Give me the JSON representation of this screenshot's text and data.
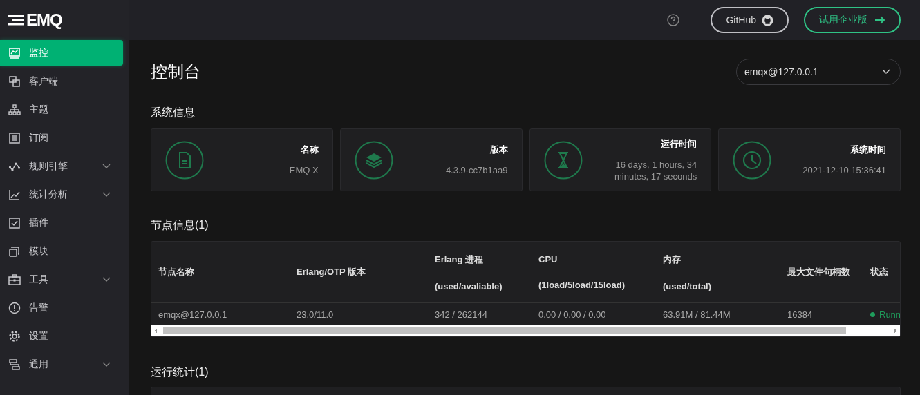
{
  "logo": {
    "text": "EMQ"
  },
  "sidebar": {
    "items": [
      {
        "label": "监控",
        "selected": true,
        "expandable": false
      },
      {
        "label": "客户端",
        "selected": false,
        "expandable": false
      },
      {
        "label": "主题",
        "selected": false,
        "expandable": false
      },
      {
        "label": "订阅",
        "selected": false,
        "expandable": false
      },
      {
        "label": "规则引擎",
        "selected": false,
        "expandable": true
      },
      {
        "label": "统计分析",
        "selected": false,
        "expandable": true
      },
      {
        "label": "插件",
        "selected": false,
        "expandable": false
      },
      {
        "label": "模块",
        "selected": false,
        "expandable": false
      },
      {
        "label": "工具",
        "selected": false,
        "expandable": true
      },
      {
        "label": "告警",
        "selected": false,
        "expandable": false
      },
      {
        "label": "设置",
        "selected": false,
        "expandable": false
      },
      {
        "label": "通用",
        "selected": false,
        "expandable": true
      }
    ]
  },
  "header": {
    "github_button": "GitHub",
    "trial_button": "试用企业版"
  },
  "page_title": "控制台",
  "node_select": {
    "value": "emqx@127.0.0.1"
  },
  "system_section": {
    "title": "系统信息",
    "cards": [
      {
        "label": "名称",
        "value": "EMQ X"
      },
      {
        "label": "版本",
        "value": "4.3.9-cc7b1aa9"
      },
      {
        "label": "运行时间",
        "value": "16 days, 1 hours, 34 minutes, 17 seconds"
      },
      {
        "label": "系统时间",
        "value": "2021-12-10 15:36:41"
      }
    ]
  },
  "nodes_section": {
    "title": "节点信息(1)",
    "table": {
      "columns": [
        {
          "label": "节点名称"
        },
        {
          "label": "Erlang/OTP 版本"
        },
        {
          "label": "Erlang 进程",
          "sublabel": "(used/avaliable)"
        },
        {
          "label": "CPU",
          "sublabel": "(1load/5load/15load)"
        },
        {
          "label": "内存",
          "sublabel": "(used/total)"
        },
        {
          "label": "最大文件句柄数"
        },
        {
          "label": "状态"
        }
      ],
      "rows": [
        {
          "cells": [
            "emqx@127.0.0.1",
            "23.0/11.0",
            "342 / 262144",
            "0.00 / 0.00 / 0.00",
            "63.91M / 81.44M",
            "16384"
          ],
          "status": {
            "text": "Runn",
            "color": "#1f9d5c"
          }
        }
      ]
    }
  },
  "stats_section": {
    "title": "运行统计(1)"
  }
}
